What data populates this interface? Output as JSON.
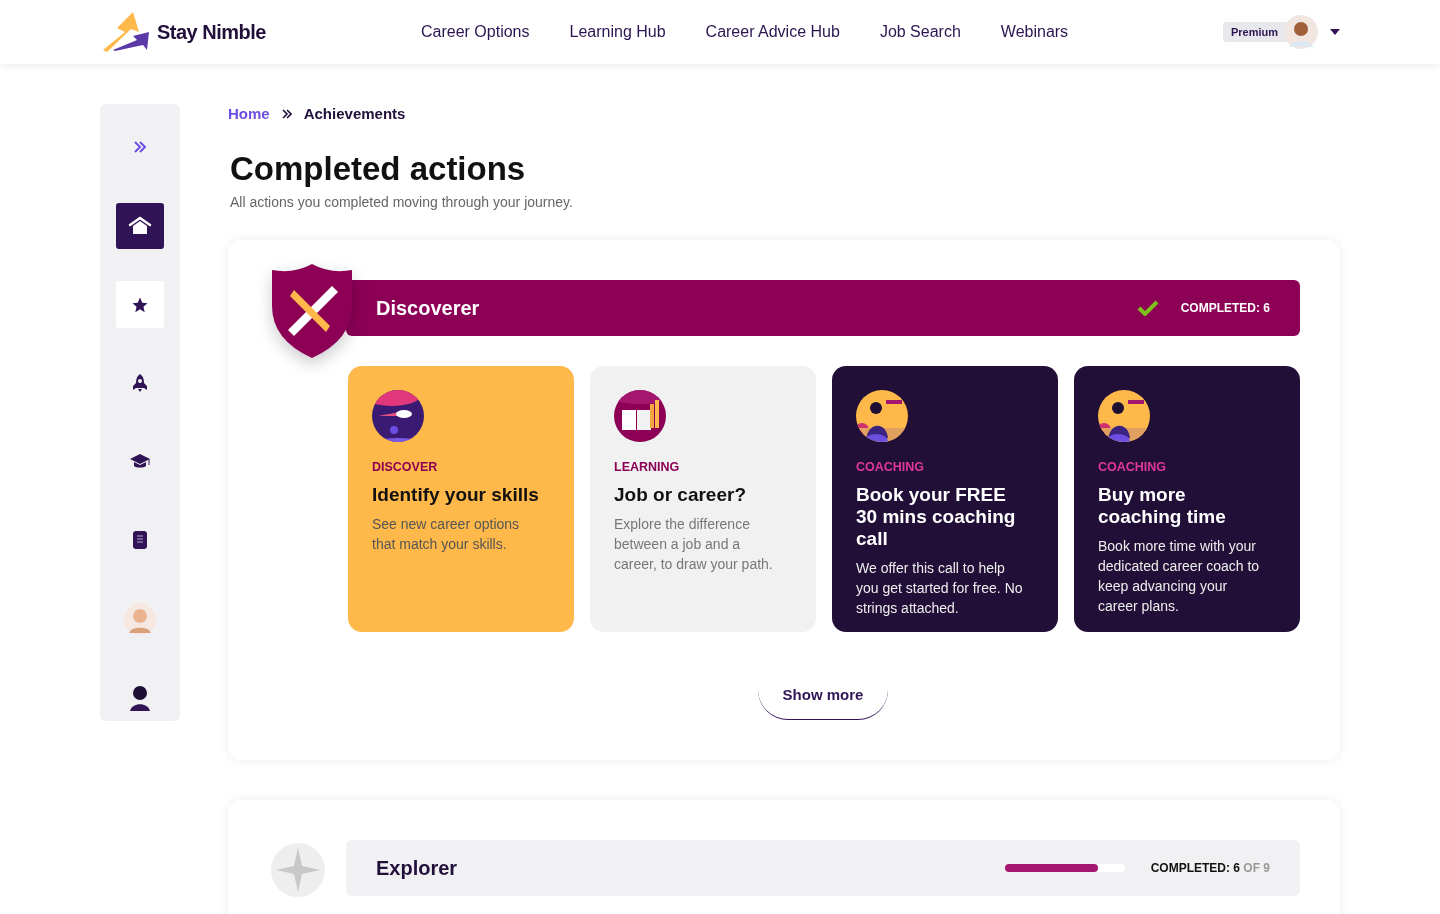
{
  "header": {
    "brand": "Stay Nimble",
    "nav": [
      "Career Options",
      "Learning Hub",
      "Career Advice Hub",
      "Job Search",
      "Webinars"
    ],
    "badge": "Premium"
  },
  "sidebar": {
    "items": [
      {
        "kind": "expand",
        "selected": false,
        "highlighted": false
      },
      {
        "kind": "home",
        "selected": true,
        "highlighted": false
      },
      {
        "kind": "star",
        "selected": false,
        "highlighted": true
      },
      {
        "kind": "rocket",
        "selected": false,
        "highlighted": false
      },
      {
        "kind": "graduation",
        "selected": false,
        "highlighted": false
      },
      {
        "kind": "notebook",
        "selected": false,
        "highlighted": false
      },
      {
        "kind": "avatar",
        "selected": false,
        "highlighted": false
      },
      {
        "kind": "coach",
        "selected": false,
        "highlighted": false
      }
    ]
  },
  "breadcrumb": [
    "Home",
    "Achievements"
  ],
  "title": "Completed actions",
  "subtitle": "All actions you completed moving through your journey.",
  "sections": [
    {
      "name": "Discoverer",
      "kind": "tools",
      "completed": true,
      "status": "COMPLETED: 6",
      "cards": [
        {
          "kind": "discover",
          "category": "DISCOVER",
          "title": "Identify your skills",
          "text": "See new career options that match your skills."
        },
        {
          "kind": "learning",
          "category": "LEARNING",
          "title": "Job or career?",
          "text": "Explore the difference between a job and a career, to draw your path."
        },
        {
          "kind": "coaching",
          "category": "COACHING",
          "title": "Book your FREE 30 mins coaching call",
          "text": "We offer this call to help you get started for free. No strings attached."
        },
        {
          "kind": "coaching",
          "category": "COACHING",
          "title": "Buy more coaching time",
          "text": "Book more time with your dedicated career coach to keep advancing your career plans."
        }
      ],
      "more": "Show more"
    },
    {
      "name": "Explorer",
      "kind": "compass",
      "completed": false,
      "status": "**COMPLETED: 6** OF 9",
      "level": 0.78
    }
  ]
}
